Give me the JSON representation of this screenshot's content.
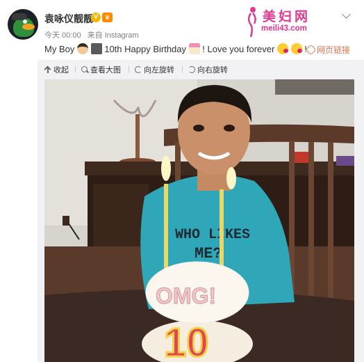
{
  "user": {
    "name": "袁咏仪靓靓",
    "verified_badge": "V",
    "vip_badge": "♛"
  },
  "meta": {
    "time": "今天 00:00",
    "source": "来自 Instagram"
  },
  "watermark": {
    "title": "美妇网",
    "url": "meili43.com"
  },
  "post": {
    "text_1": "My Boy",
    "text_2": " 10th Happy Birthday",
    "text_3": "! Love you forever ",
    "text_4": "!",
    "emoji": [
      "boy-emoji",
      "box-emoji",
      "cake-emoji",
      "kiss-emoji",
      "kiss-emoji"
    ]
  },
  "weblink": {
    "label": "网页链接",
    "icon": "link-icon"
  },
  "toolbar": {
    "collapse": "收起",
    "view_large": "查看大图",
    "rotate_left": "向左旋转",
    "rotate_right": "向右旋转"
  },
  "photo": {
    "cake_text": "OMG!",
    "candle_number": "10",
    "shirt_text_1": "WHO LIKES",
    "shirt_text_2": "ME?"
  },
  "colors": {
    "accent": "#eb7350",
    "watermark": "#e3388d",
    "verified": "#f7b500",
    "shirt": "#2fa7b9"
  }
}
